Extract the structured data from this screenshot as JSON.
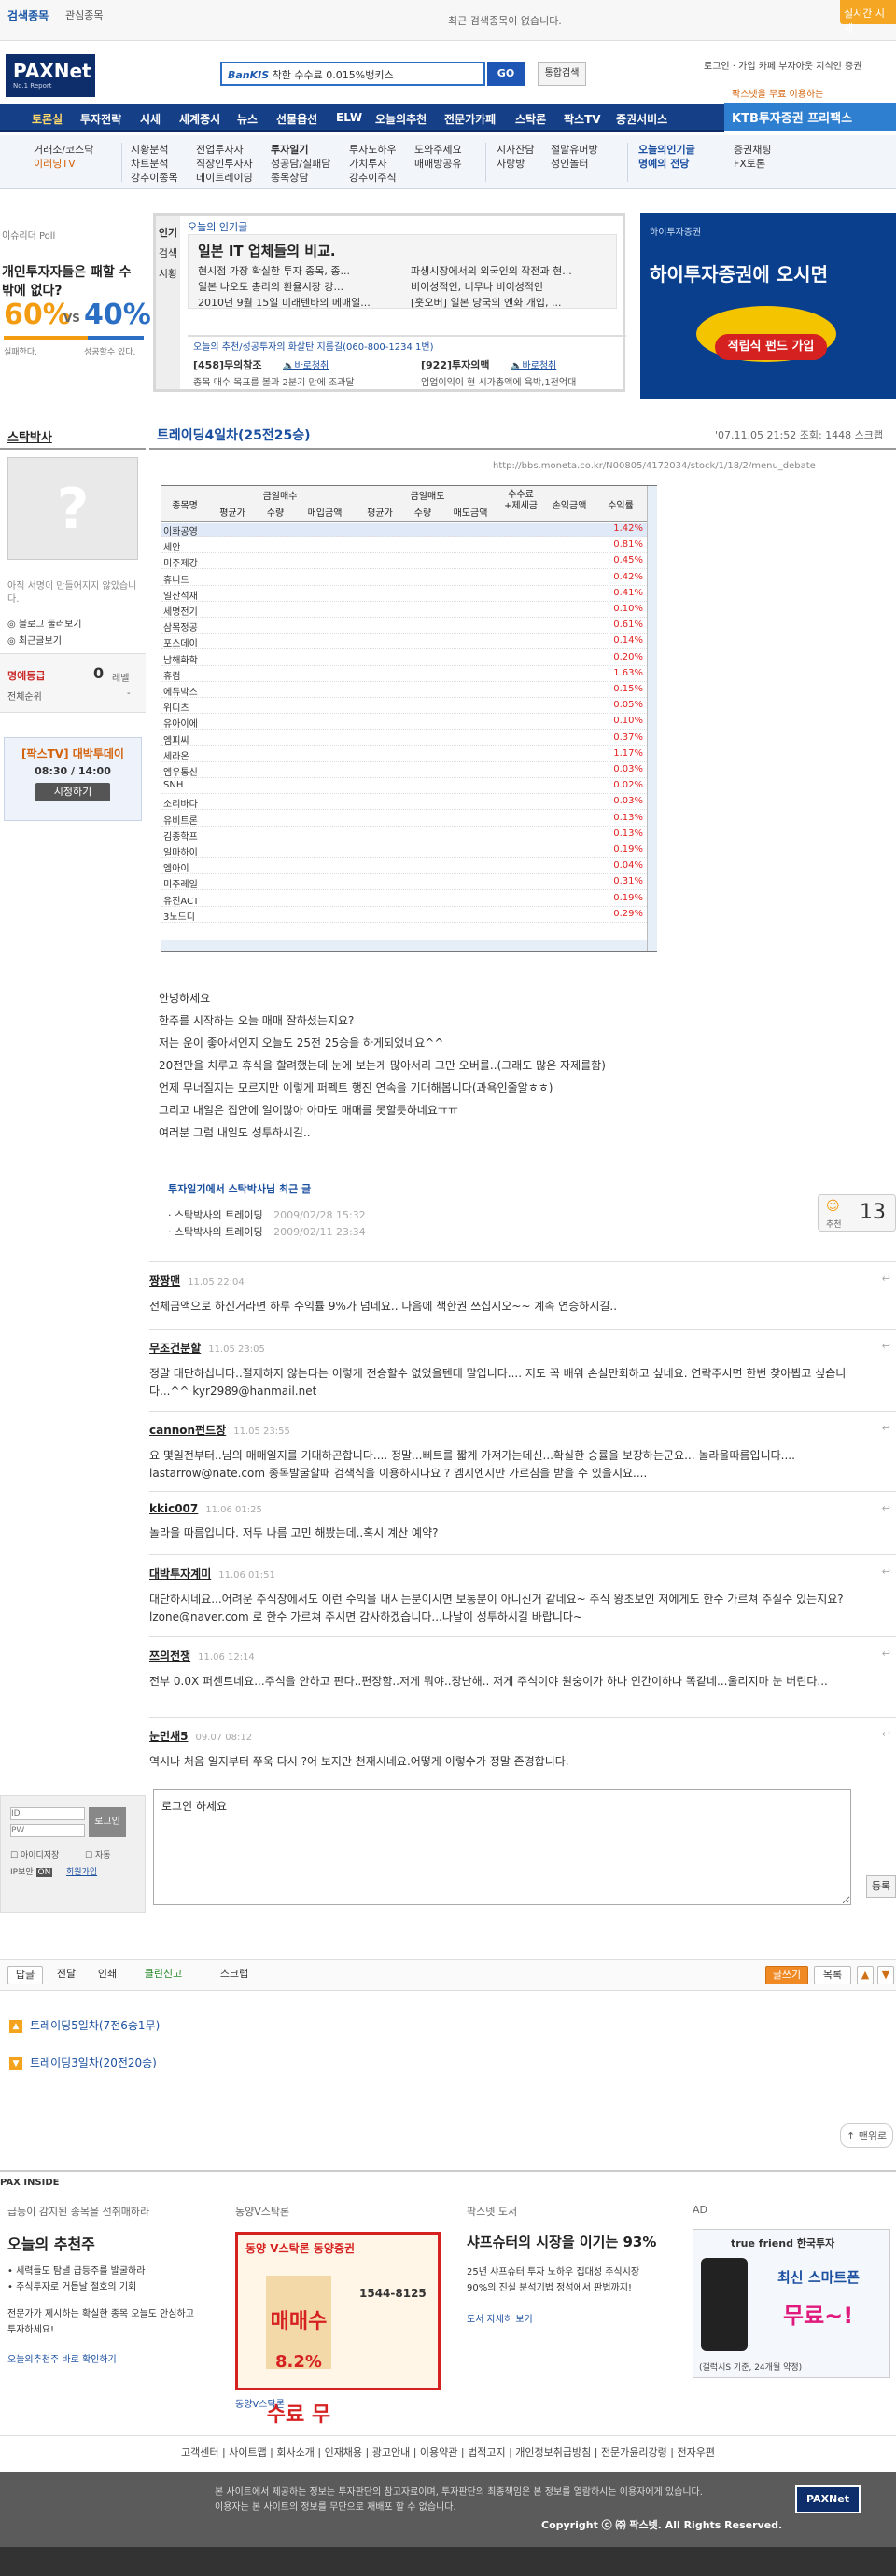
{
  "topbar": {
    "tab_search": "검색종목",
    "tab_fav": "관심종목",
    "notice": "최근 검색종목이 없습니다.",
    "realtime": "실시간 시세"
  },
  "header": {
    "logo_text": "PAXNet",
    "logo_sub": "No.1 Report",
    "search_ad_brand": "BanKIS",
    "search_ad_text": " 착한 수수료 0.015%뱅키스",
    "search_button": "GO",
    "integrated_search": "통합검색",
    "user_links": "로그인 · 가입   카페   부자아웃   지식인   증권",
    "promo": "팍스넷을 무료 이용하는",
    "ktb": "KTB투자증권 프리팩스"
  },
  "gnb": [
    "토론실",
    "투자전략",
    "시세",
    "세계증시",
    "뉴스",
    "선물옵션",
    "ELW",
    "오늘의추천",
    "전문가카페",
    "스탁론",
    "팍스TV",
    "증권서비스"
  ],
  "subnav": [
    [
      "거래소/코스닥",
      "이러닝TV"
    ],
    [
      "시황분석",
      "차트분석",
      "강추이종목"
    ],
    [
      "전업투자자",
      "직장인투자자",
      "데이트레이딩"
    ],
    [
      "투자일기",
      "성공담/실패담",
      "종목상담"
    ],
    [
      "투자노하우",
      "가치투자",
      "강추이주식"
    ],
    [
      "도와주세요",
      "매매방공유"
    ],
    [
      "시사잔담",
      "사랑방"
    ],
    [
      "절말유머방",
      "성인놀터"
    ],
    [
      "오늘의인기글",
      "명예의 전당"
    ],
    [
      "증권채팅",
      "FX토론"
    ]
  ],
  "poll": {
    "label": "이슈리더 Poll",
    "question": "개인투자자들은 패할 수 밖에 없다?",
    "left_pct": "60%",
    "vs": "VS",
    "right_pct": "40%",
    "left_label": "실패한다.",
    "right_label": "성공할수 있다."
  },
  "popular": {
    "tabs": [
      "인기",
      "검색",
      "시황"
    ],
    "title": "오늘의 인기글",
    "headline": "일본 IT 업체들의 비교.",
    "items_left": [
      "현시점 가장 확실한 투자 종목, 종...",
      "일본 나오토 총리의 환율시장 강...",
      "2010년 9월 15일 미래텐바의 메매일..."
    ],
    "items_right": [
      "파생시장에서의 외국인의 작전과 현...",
      "비이성적인, 너무나 비이성적인",
      "[훗오버] 일본 당국의 엔화 개입, ..."
    ],
    "phone_line": "오늘의 추천/성공투자의 화살탄 지름길(060-800-1234 1번)",
    "rec_left": "[458]무의참조",
    "rec_right": "[922]투자의맥",
    "rec_left_link": "바로청취",
    "rec_right_link": "바로청취",
    "rec_left_desc": "종목 매수 목표를 볼과 2분기 만에 조과달",
    "rec_right_desc": "엄업이익이 현 시가총액에 육박,1천억대"
  },
  "banner": {
    "brand": "하이투자증권",
    "text": "하이투자증권에 오시면",
    "tag": "적립식 펀드 가입"
  },
  "sidebar": {
    "author": "스탁박사",
    "profile_note": "아직 서명이 만들어지지 않았습니다.",
    "blog_link": "블로그 둘러보기",
    "recent_link": "최근글보기",
    "honor_label": "명예등급",
    "honor_value": "0",
    "honor_unit": "레벨",
    "rank_label": "전체순위",
    "rank_value": "-",
    "tv_label": "[팍스TV] 대박투데이",
    "tv_time": "08:30 / 14:00",
    "tv_button": "시청하기"
  },
  "post": {
    "title": "트레이딩4일차(25전25승)",
    "meta": "'07.11.05 21:52   조회: 1448  스크랩",
    "url": "http://bbs.moneta.co.kr/N00805/4172034/stock/1/18/2/menu_debate",
    "headers": {
      "name": "종목명",
      "buy_group": "금일매수",
      "sell_group": "금일매도",
      "avg": "평균가",
      "qty": "수량",
      "buy_amt": "매입금액",
      "sell_amt": "매도금액",
      "fee": "수수료 +제세금",
      "pnl": "손익금액",
      "rate": "수익률"
    },
    "rows": [
      [
        "이화공영",
        "1.42%"
      ],
      [
        "세안",
        "0.81%"
      ],
      [
        "미주제강",
        "0.45%"
      ],
      [
        "휴니드",
        "0.42%"
      ],
      [
        "일산석재",
        "0.41%"
      ],
      [
        "세명전기",
        "0.10%"
      ],
      [
        "삼목정공",
        "0.61%"
      ],
      [
        "포스데이",
        "0.14%"
      ],
      [
        "남해화학",
        "0.20%"
      ],
      [
        "휴컴",
        "1.63%"
      ],
      [
        "에듀박스",
        "0.15%"
      ],
      [
        "위디츠",
        "0.05%"
      ],
      [
        "유아이에",
        "0.10%"
      ],
      [
        "엠피씨",
        "0.37%"
      ],
      [
        "세라온",
        "1.17%"
      ],
      [
        "엠우통신",
        "0.03%"
      ],
      [
        "SNH",
        "0.02%"
      ],
      [
        "소리바다",
        "0.03%"
      ],
      [
        "유비트론",
        "0.13%"
      ],
      [
        "김종학프",
        "0.13%"
      ],
      [
        "일마하이",
        "0.19%"
      ],
      [
        "엠아이",
        "0.04%"
      ],
      [
        "미주레일",
        "0.31%"
      ],
      [
        "유진ACT",
        "0.19%"
      ],
      [
        "3노드디",
        "0.29%"
      ]
    ],
    "body": [
      "안녕하세요",
      "한주를 시작하는 오늘 매매 잘하셨는지요?",
      "저는 운이 좋아서인지 오늘도 25전 25승을 하게되었네요^^",
      "20전만을 치루고 휴식을 할려했는데 눈에 보는게 많아서리 그만 오버를..(그래도 많은 자제를함)",
      "언제 무너질지는 모르지만 이렇게 퍼펙트 행진 연속을 기대해봅니다(과욕인줄알ㅎㅎ)",
      "그리고 내일은 집안에 일이많아 아마도 매매를 못할듯하네요ㅠㅠ",
      "여러분 그럼 내일도 성투하시길.."
    ],
    "recent_title": "투자일기에서 스탁박사님 최근 글",
    "recent": [
      {
        "title": "스탁박사의 트레이딩",
        "date": "2009/02/28 15:32"
      },
      {
        "title": "스탁박사의 트레이딩",
        "date": "2009/02/11 23:34"
      }
    ],
    "recommend_label": "추천",
    "recommend_count": "13"
  },
  "comments": [
    {
      "who": "짱짱맨",
      "when": "11.05 22:04",
      "text": "전체금액으로 하신거라면 하루 수익률 9%가 넘네요.. 다음에 책한권 쓰십시오~~ 계속 연승하시길.."
    },
    {
      "who": "무조건분할",
      "when": "11.05 23:05",
      "text": "정말 대단하십니다..절제하지 않는다는 이렇게 전승할수 없었을텐데 말입니다.... 저도 꼭 배워 손실만회하고 싶네요. 연락주시면 한번 찾아뵙고 싶습니다...^^ kyr2989@hanmail.net"
    },
    {
      "who": "cannon펀드장",
      "when": "11.05 23:55",
      "text": "요 몇일전부터..님의 매매일지를 기대하곤합니다.... 정말...삐트를 짧게 가져가는데신...확실한 승률을 보장하는군요... 놀라울따름입니다.... lastarrow@nate.com 종목발굴할때 검색식을 이용하시나요 ? 엠지엔지만 가르침을 받을 수 있을지요...."
    },
    {
      "who": "kkic007",
      "when": "11.06 01:25",
      "text": "놀라울 따름입니다. 저두 나름 고민 해봤는데..혹시 계산 예약?"
    },
    {
      "who": "대박투자계미",
      "when": "11.06 01:51",
      "text": "대단하시네요...어려운 주식장에서도 이런 수익을 내시는분이시면 보통분이 아니신거 같네요~ 주식 왕초보인 저에게도 한수 가르쳐 주실수 있는지요? lzone@naver.com 로 한수 가르쳐 주시면 감사하겠습니다...나날이 성투하시길 바랍니다~"
    },
    {
      "who": "쯔의전쟁",
      "when": "11.06 12:14",
      "text": "전부 0.0X 퍼센트네요...주식을 안하고 판다..편장함..저게 뭐야..장난해.. 저게 주식이야 원숭이가 하나 인간이하나 똑같네...울리지마 눈 버린다..."
    },
    {
      "who": "눈먼새5",
      "when": "09.07 08:12",
      "text": "역시나 처음 일지부터 쭈욱 다시 ?어 보지만 천재시네요.어떻게 이렇수가 정말 존경합니다."
    }
  ],
  "reply": {
    "id_placeholder": "ID",
    "pw_placeholder": "PW",
    "login_btn": "로그인",
    "save_id": "아이디저장",
    "auto": "자동",
    "ip_label": "IP보안",
    "ip_status": "ON",
    "signup": "회원가입",
    "textarea_value": "로그인 하세요",
    "register": "등록"
  },
  "actions": {
    "left": [
      "답글",
      "전달",
      "인쇄",
      "클린신고",
      "스크랩"
    ],
    "write": "글쓰기",
    "list": "목록",
    "up": "▲",
    "down": "▼"
  },
  "prev_next": {
    "next": "트레이딩5일차(7전6승1무)",
    "prev": "트레이딩3일차(20전20승)",
    "top": "맨위로"
  },
  "paxinside": {
    "label": "PAX INSIDE",
    "col1_head": "급등이 감지된 종목을 선취매하라",
    "col1_title": "오늘의 추천주",
    "col1_items": [
      "세력들도 탐낼 급등주를 발굴하라",
      "주식투자로 거듭날 절호의 기회"
    ],
    "col1_desc": "전문가가 제시하는 확실한 종목 오늘도 안심하고 투자하세요!",
    "col1_link": "오늘의추천주 바로 확인하기",
    "col2_head": "동양V스탁론",
    "col2_ad": "동양 V스탁론 동양증권",
    "col2_tag": "매매수수료 무료",
    "col2_rate": "8.2%",
    "col2_phone": "1544-8125",
    "col2_link": "동양V스탁론",
    "col3_head": "팍스넷 도서",
    "col3_title": "샤프슈터의 시장을 이기는 93%",
    "col3_desc": "25년 샤프슈터 투자 노하우 집대성 주식시장 90%의 진실 분석기법 정석에서 판법까지!",
    "col3_link": "도서 자세히 보기",
    "col4_head": "AD",
    "col4_brand": "true friend 한국투자",
    "col4_title": "최신 스마트폰",
    "col4_tag": "무료~!",
    "col4_note": "(갤럭시S 기준, 24개월 약정)"
  },
  "footer": {
    "links": "고객센터 | 사이트맵 | 회사소개 | 인재채용 | 광고안내 | 이용약관 | 법적고지 | 개인정보취급방침 | 전문가윤리강령 | 전자우편",
    "disclaimer1": "본 사이트에서 제공하는 정보는 투자판단의 참고자료이며, 투자판단의 최종책임은 본 정보를 열람하시는 이용자에게 있습니다.",
    "disclaimer2": "이용자는 본 사이트의 정보를 무단으로 재배포 할 수 없습니다.",
    "copyright": "Copyright ⓒ ㈜ 팍스넷. All Rights Reserved."
  },
  "colors": {
    "brand": "#153f86",
    "accent": "#f5a623",
    "red": "#e21e1e"
  }
}
